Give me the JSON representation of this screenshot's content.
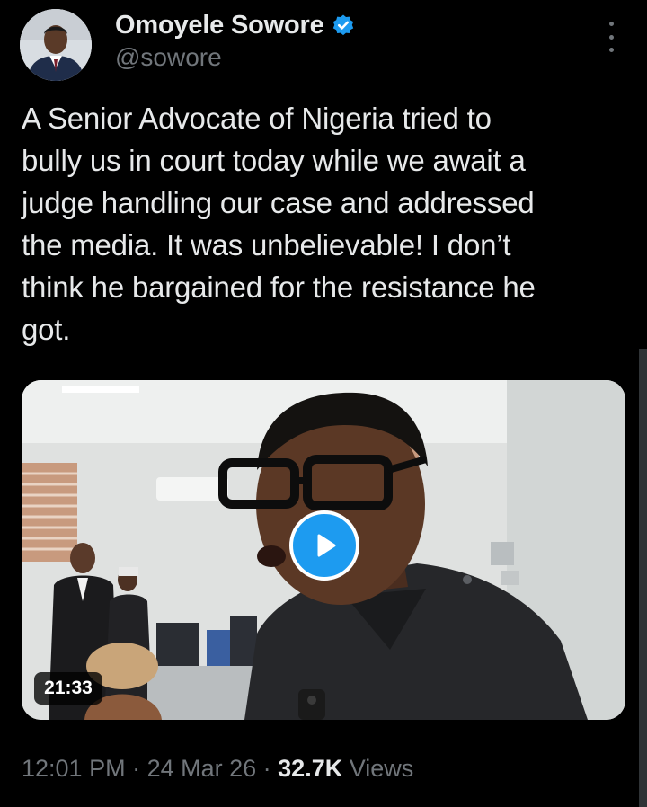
{
  "author": {
    "display_name": "Omoyele Sowore",
    "handle": "@sowore",
    "verified_color": "#1d9bf0",
    "avatar_icon": "profile-photo"
  },
  "tweet": {
    "text": "A Senior Advocate of Nigeria tried to\nbully us in court today while we await a\njudge handling our case and addressed\nthe media. It was unbelievable! I don’t\nthink he bargained for the resistance he\ngot."
  },
  "media": {
    "type": "video",
    "duration": "21:33",
    "play_icon": "play-icon"
  },
  "meta": {
    "time": "12:01 PM",
    "separator": " · ",
    "date": "24 Mar 26",
    "views_count": "32.7K",
    "views_label": "Views"
  },
  "colors": {
    "background": "#000000",
    "text_primary": "#e7e9ea",
    "text_secondary": "#71767b",
    "accent": "#1d9bf0"
  }
}
